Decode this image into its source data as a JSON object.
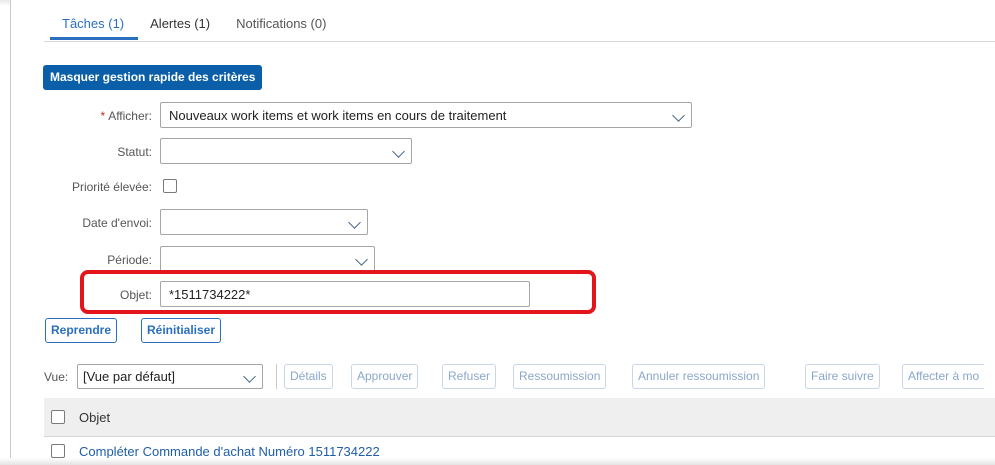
{
  "tabs": [
    {
      "label": "Tâches (1)",
      "active": true
    },
    {
      "label": "Alertes (1)",
      "active": false
    },
    {
      "label": "Notifications (0)",
      "active": false
    }
  ],
  "quick_criteria_button": "Masquer gestion rapide des critères",
  "form": {
    "afficher": {
      "label": "Afficher:",
      "value": "Nouveaux work items et work items en cours de traitement"
    },
    "statut": {
      "label": "Statut:",
      "value": ""
    },
    "priorite": {
      "label": "Priorité élevée:"
    },
    "date_envoi": {
      "label": "Date d'envoi:",
      "value": ""
    },
    "periode": {
      "label": "Période:",
      "value": ""
    },
    "objet": {
      "label": "Objet:",
      "value": "*1511734222*"
    }
  },
  "actions": {
    "reprendre": "Reprendre",
    "reinitialiser": "Réinitialiser"
  },
  "toolbar": {
    "vue_label": "Vue:",
    "vue_value": "[Vue par défaut]",
    "buttons": [
      "Détails",
      "Approuver",
      "Refuser",
      "Ressoumission",
      "Annuler ressoumission",
      "Faire suivre",
      "Affecter à mo"
    ]
  },
  "table": {
    "header": "Objet",
    "rows": [
      {
        "objet": "Compléter Commande d'achat Numéro 1511734222"
      }
    ]
  },
  "colors": {
    "accent": "#0a5fa8",
    "highlight": "#e4141b",
    "link": "#1f5ea8"
  }
}
